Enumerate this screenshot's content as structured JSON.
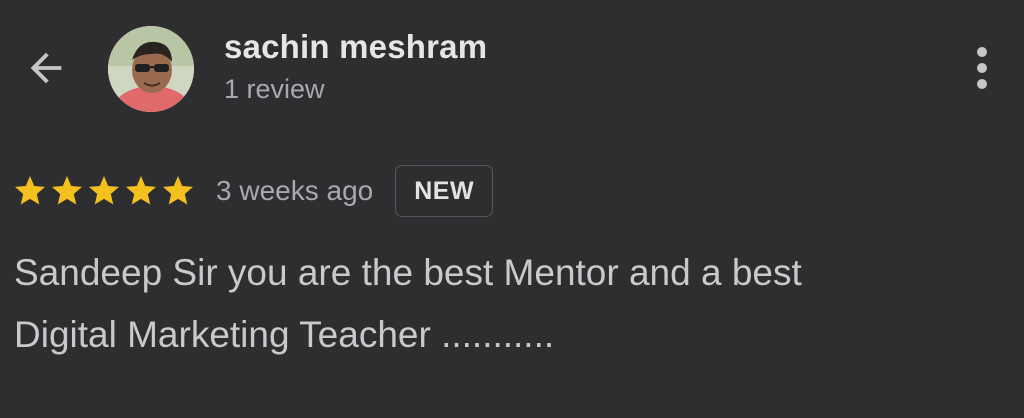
{
  "header": {
    "back_icon": "arrow-back-icon",
    "reviewer_name": "sachin meshram",
    "review_count": "1 review",
    "more_icon": "more-vertical-icon"
  },
  "review": {
    "rating": 5,
    "rating_max": 5,
    "time_ago": "3 weeks ago",
    "badge": "NEW",
    "text": "Sandeep Sir you are the best Mentor and a best\nDigital Marketing Teacher ..........."
  },
  "colors": {
    "background": "#2e2e31",
    "star": "#f4c01e",
    "text_primary": "#e6e6e8",
    "text_secondary": "#a9a9ad"
  }
}
